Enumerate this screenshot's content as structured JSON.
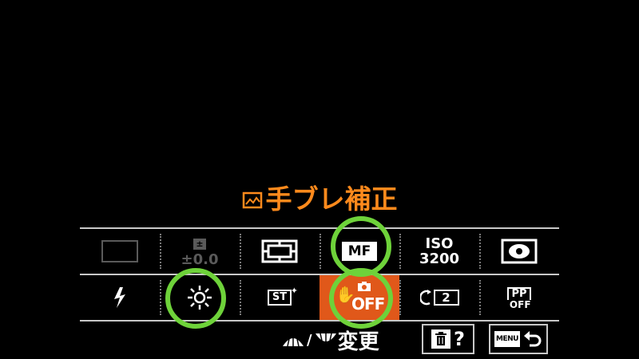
{
  "title": {
    "text": "手ブレ補正",
    "icon": "steadyshot-frame-icon"
  },
  "accent_color": "#e0581a",
  "title_color": "#ff8a1c",
  "highlight_color": "#6ed23a",
  "row1": {
    "ev_label": "±0.0",
    "ev_icon": "exposure-compensation-icon",
    "focus_area_icon": "focus-area-icon",
    "focus_mode_label": "MF",
    "iso_top": "ISO",
    "iso_value": "3200",
    "metering_icon": "metering-mode-icon"
  },
  "row2": {
    "flash_icon": "flash-icon",
    "white_balance_icon": "white-balance-daylight-icon",
    "creative_style_label": "ST",
    "steadyshot_label": "OFF",
    "steadyshot_icon": "steadyshot-hand-icon",
    "drive_value": "2",
    "drive_icon": "self-timer-icon",
    "picture_profile_top": "PP",
    "picture_profile_bottom": "OFF"
  },
  "footer": {
    "change_text": "変更",
    "separator": "/",
    "dial_icons": [
      "front-dial-icon",
      "rear-dial-icon"
    ],
    "delete_icon": "trash-icon",
    "help_label": "?",
    "menu_label": "MENU",
    "back_icon": "return-icon"
  }
}
